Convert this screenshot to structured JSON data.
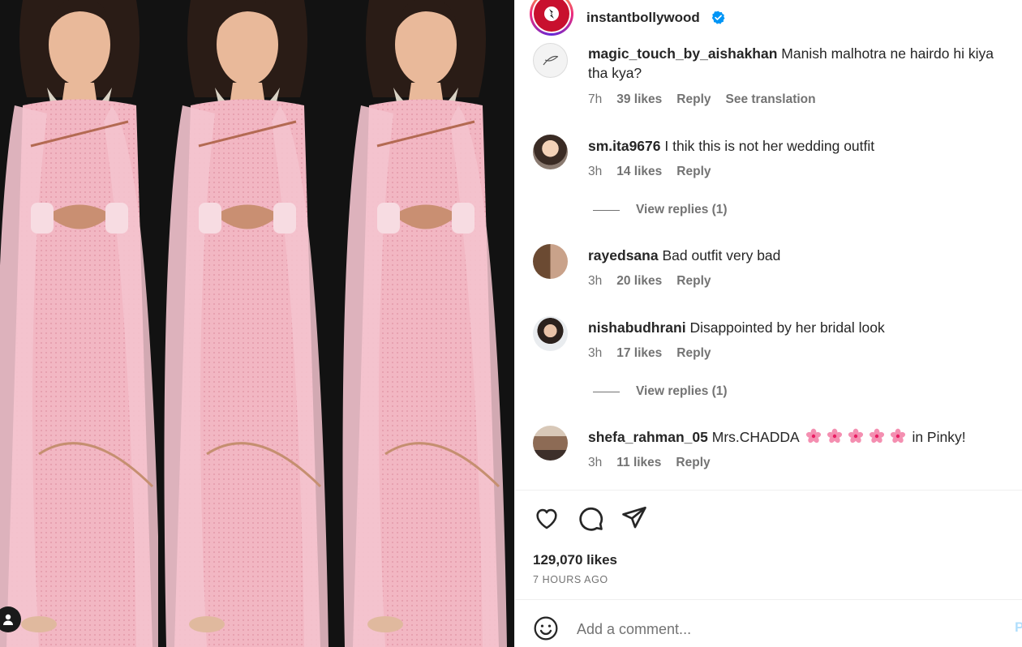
{
  "post": {
    "account": "instantbollywood",
    "verified_icon": "verified-badge-icon",
    "image_description_colors": {
      "saree": "#f2b7c3",
      "background": "#0f0f0f"
    }
  },
  "comments": [
    {
      "user": "magic_touch_by_aishakhan",
      "text": "Manish malhotra ne hairdo hi kiya tha kya?",
      "time": "7h",
      "likes": "39 likes",
      "reply": "Reply",
      "translation": "See translation"
    },
    {
      "user": "sm.ita9676",
      "text": "I thik this is not her wedding outfit",
      "time": "3h",
      "likes": "14 likes",
      "reply": "Reply",
      "view_replies": "View replies (1)"
    },
    {
      "user": "rayedsana",
      "text": "Bad outfit very bad",
      "time": "3h",
      "likes": "20 likes",
      "reply": "Reply"
    },
    {
      "user": "nishabudhrani",
      "text": "Disappointed by her bridal look",
      "time": "3h",
      "likes": "17 likes",
      "reply": "Reply",
      "view_replies": "View replies (1)"
    },
    {
      "user": "shefa_rahman_05",
      "text_before": "Mrs.CHADDA",
      "text_after": "in Pinky!",
      "emoji_count": 5,
      "emoji_name": "cherry-blossom-icon",
      "time": "3h",
      "likes": "11 likes",
      "reply": "Reply"
    }
  ],
  "footer": {
    "likes": "129,070 likes",
    "posted": "7 HOURS AGO",
    "comment_placeholder": "Add a comment...",
    "post_label": "Post",
    "icons": [
      "heart-icon",
      "comment-icon",
      "share-icon",
      "emoji-icon"
    ]
  }
}
